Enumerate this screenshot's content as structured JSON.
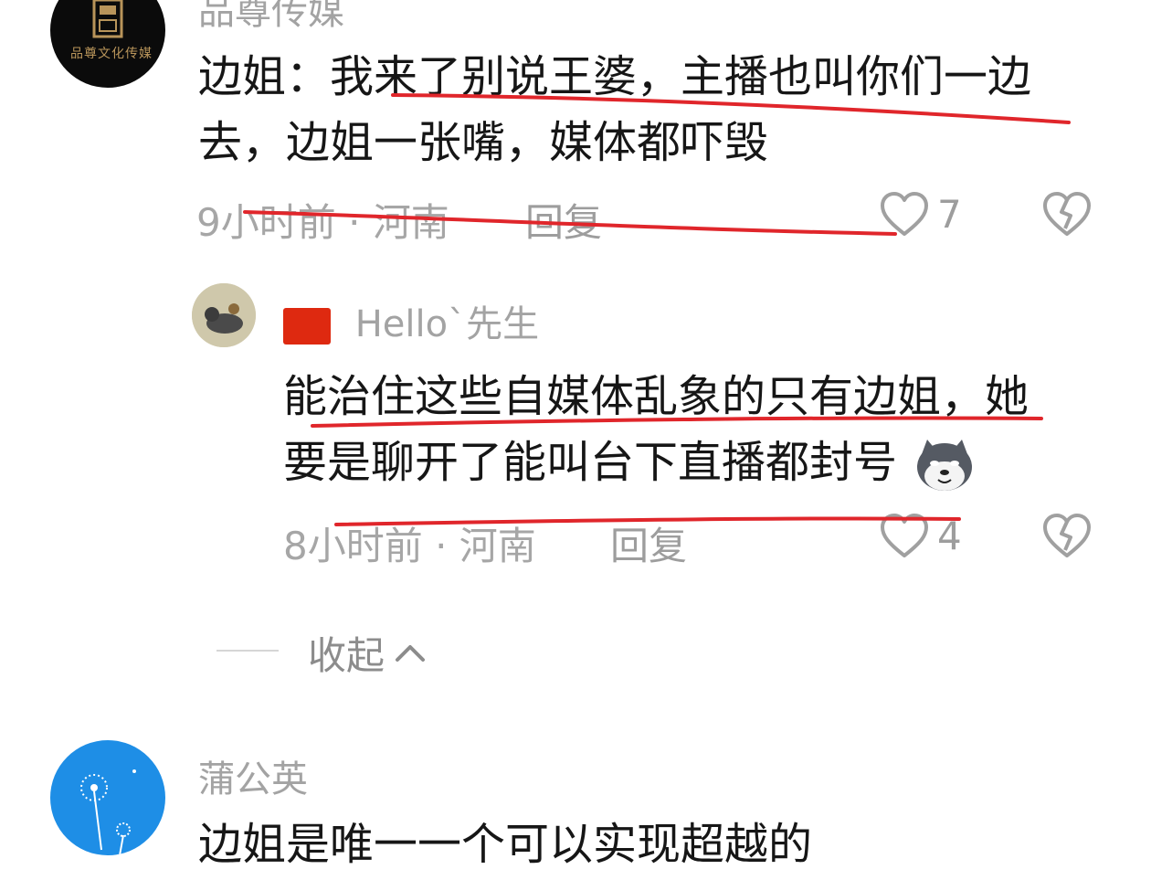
{
  "comments": [
    {
      "username": "品尊传媒",
      "avatar_text": "品尊文化传媒",
      "content_line1": "边姐：我来了别说王婆，主播也叫你们一边",
      "content_line2": "去，边姐一张嘴，媒体都吓毁",
      "time": "9小时前",
      "location": "河南",
      "reply_label": "回复",
      "likes": "7"
    }
  ],
  "replies": [
    {
      "flag": "🇨🇳",
      "username": "Hello`先生",
      "content_line1": "能治住这些自媒体乱象的只有边姐，她",
      "content_line2": "要是聊开了能叫台下直播都封号",
      "time": "8小时前",
      "location": "河南",
      "reply_label": "回复",
      "likes": "4"
    }
  ],
  "collapse": {
    "label": "收起"
  },
  "next_comment": {
    "username": "蒲公英",
    "content": "边姐是唯一一个可以实现超越的"
  },
  "colors": {
    "annotation_red": "#e0262b",
    "muted_text": "#a6a6a6"
  },
  "icons": [
    "heart-outline-icon",
    "broken-heart-icon",
    "chevron-up-icon",
    "shiba-emoji-icon"
  ]
}
